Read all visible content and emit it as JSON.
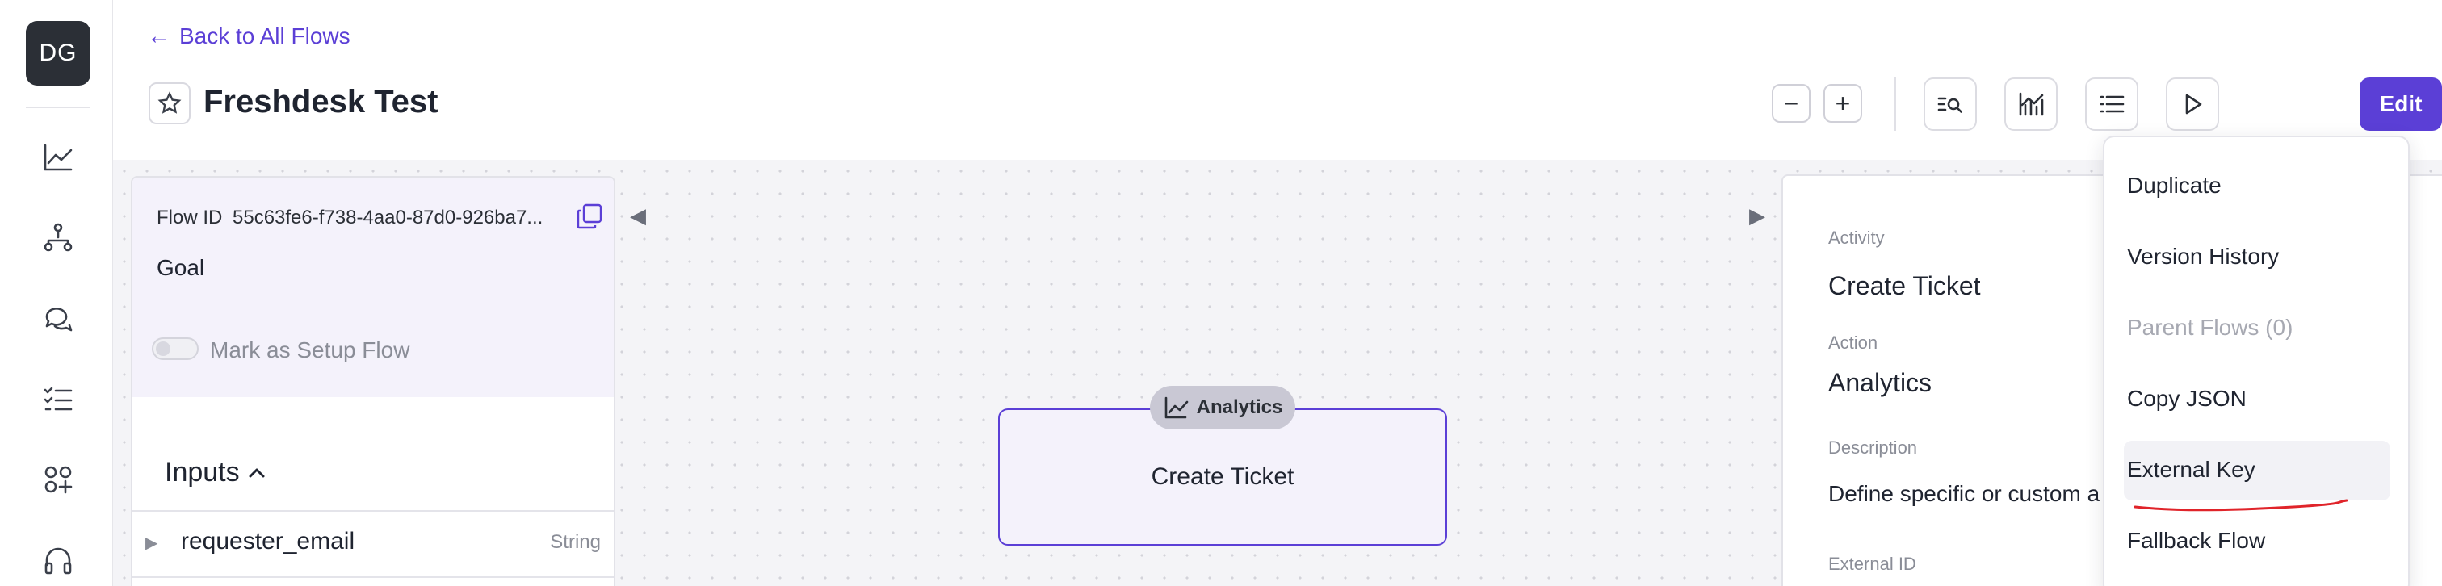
{
  "user": {
    "initials": "DG"
  },
  "sidebar": {
    "icons": [
      "analytics-icon",
      "hierarchy-icon",
      "chat-icon",
      "checklist-icon",
      "apps-add-icon",
      "headset-icon"
    ]
  },
  "header": {
    "back_label": "Back to All Flows",
    "title": "Freshdesk Test",
    "zoom_out": "−",
    "zoom_in": "+",
    "edit_label": "Edit",
    "more_label": "···"
  },
  "left_panel": {
    "flow_id_label": "Flow ID",
    "flow_id_value": "55c63fe6-f738-4aa0-87d0-926ba7...",
    "goal": "Goal",
    "setup_toggle_label": "Mark as Setup Flow",
    "setup_toggle_on": false,
    "inputs_title": "Inputs",
    "inputs": [
      {
        "name": "requester_email",
        "type": "String"
      }
    ]
  },
  "node": {
    "badge": "Analytics",
    "title": "Create Ticket"
  },
  "right_panel": {
    "activity_label": "Activity",
    "activity_value": "Create Ticket",
    "action_label": "Action",
    "action_value": "Analytics",
    "description_label": "Description",
    "description_value": "Define specific or custom a",
    "external_id_label": "External ID"
  },
  "menu": {
    "items": [
      {
        "label": "Duplicate",
        "disabled": false
      },
      {
        "label": "Version History",
        "disabled": false
      },
      {
        "label": "Parent Flows  (0)",
        "disabled": true
      },
      {
        "label": "Copy JSON",
        "disabled": false
      },
      {
        "label": "External Key",
        "disabled": false,
        "hovered": true
      },
      {
        "label": "Fallback Flow",
        "disabled": false
      }
    ]
  },
  "colors": {
    "accent": "#5b3fd6",
    "annotation": "#e0242a"
  }
}
